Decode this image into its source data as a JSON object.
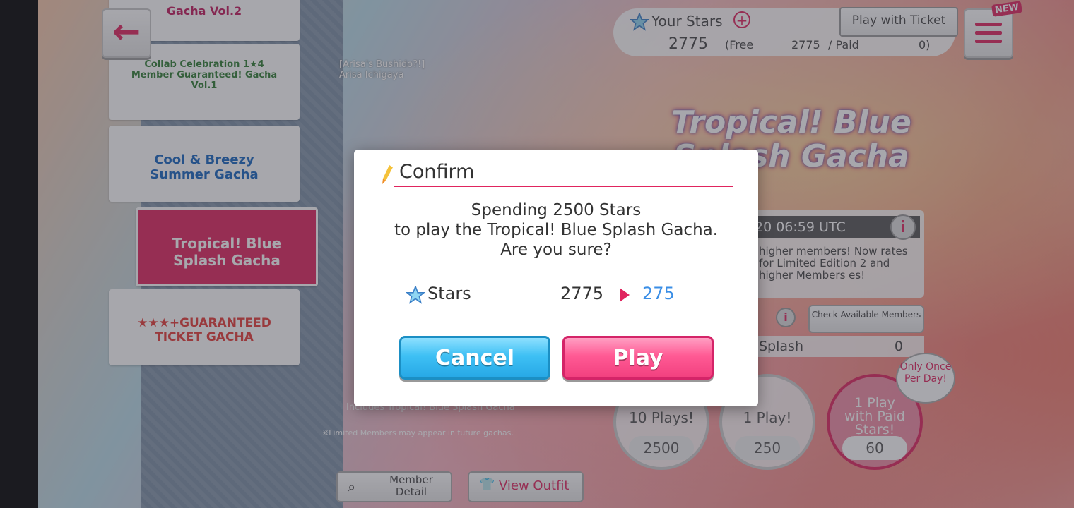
{
  "background": {
    "back_label": "←",
    "banners": [
      {
        "text": "Gacha Vol.2"
      },
      {
        "text": "Collab Celebration 1★4 Member Guaranteed! Gacha Vol.1"
      },
      {
        "text": "Cool & Breezy Summer Gacha"
      },
      {
        "text": "Tropical! Blue Splash Gacha"
      },
      {
        "text": "★★★+GUARANTEED TICKET GACHA"
      }
    ],
    "your_stars_label": "Your Stars",
    "stars_total": "2775",
    "free_label": "(Free",
    "free_value": "2775",
    "paid_label": "/ Paid",
    "paid_value": "0)",
    "play_with_ticket": "Play with Ticket",
    "new_badge": "NEW",
    "character_caption": "[Arisa's Bushido?!] Arisa Ichigaya",
    "gacha_logo": "Tropical! Blue Splash Gacha",
    "time_text": "20 06:59 UTC",
    "info_text": "higher members! Now rates for Limited Edition 2 and higher Members es!",
    "check_members": "Check Available Members",
    "splash_label": "Splash",
    "splash_count": "0",
    "ten_plays": "10 Plays!",
    "ten_cost": "2500",
    "one_play": "1 Play!",
    "one_cost": "250",
    "paid_play": "1 Play with Paid Stars!",
    "paid_cost": "60",
    "once_per_day": "Only Once Per Day!",
    "includes_note": "Includes Tropical! Blue Splash Gacha",
    "limited_note": "※Limited Members may appear in future gachas.",
    "member_detail": "Member Detail",
    "view_outfit": "View Outfit"
  },
  "modal": {
    "title": "Confirm",
    "message_line1": "Spending 2500 Stars",
    "message_line2": "to play the Tropical! Blue Splash Gacha.",
    "message_line3": "Are you sure?",
    "stars_label": "Stars",
    "stars_before": "2775",
    "stars_after": "275",
    "cancel_label": "Cancel",
    "play_label": "Play"
  },
  "colors": {
    "accent_pink": "#e0245e",
    "after_blue": "#3a8ee6",
    "cancel_blue": "#3ec0f4",
    "play_pink": "#ff5a94"
  }
}
